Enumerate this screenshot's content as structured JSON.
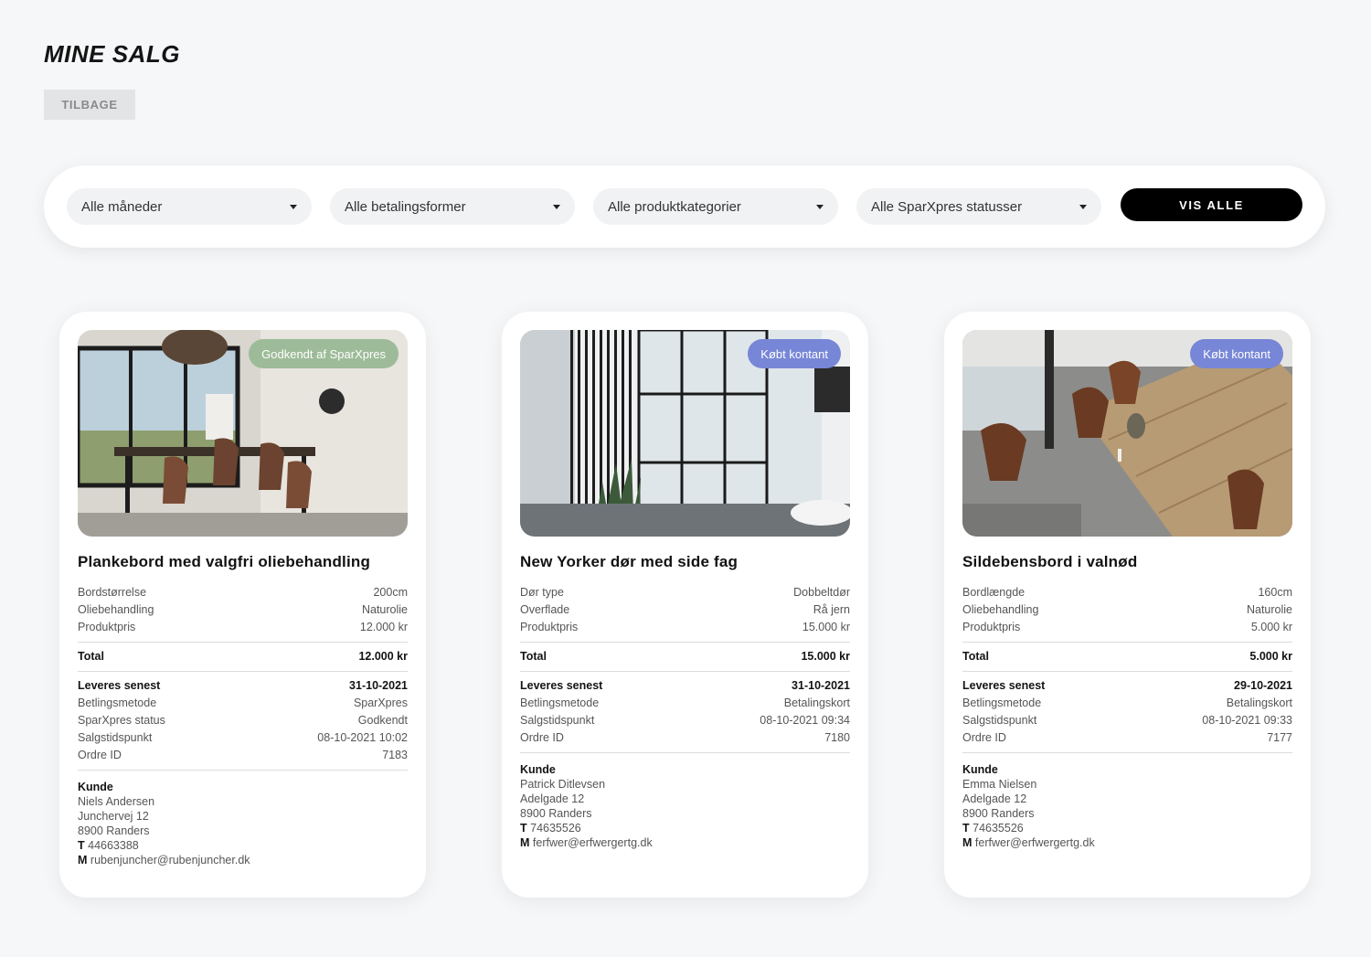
{
  "page": {
    "title": "MINE SALG",
    "back_label": "TILBAGE"
  },
  "filters": {
    "months": "Alle måneder",
    "payment": "Alle betalingsformer",
    "category": "Alle produktkategorier",
    "status": "Alle SparXpres statusser",
    "show_all": "VIS ALLE"
  },
  "colors": {
    "badge_green": "#9dbb98",
    "badge_blue": "#7786d6"
  },
  "cards": [
    {
      "badge": "Godkendt af SparXpres",
      "title": "Plankebord med valgfri oliebehandling",
      "specs": [
        {
          "label": "Bordstørrelse",
          "value": "200cm"
        },
        {
          "label": "Oliebehandling",
          "value": "Naturolie"
        },
        {
          "label": "Produktpris",
          "value": "12.000 kr"
        }
      ],
      "total": {
        "label": "Total",
        "value": "12.000 kr"
      },
      "delivery": {
        "label": "Leveres senest",
        "value": "31-10-2021"
      },
      "details": [
        {
          "label": "Betlingsmetode",
          "value": "SparXpres"
        },
        {
          "label": "SparXpres status",
          "value": "Godkendt"
        },
        {
          "label": "Salgstidspunkt",
          "value": "08-10-2021 10:02"
        },
        {
          "label": "Ordre ID",
          "value": "7183"
        }
      ],
      "customer": {
        "heading": "Kunde",
        "name": "Niels Andersen",
        "street": "Junchervej 12",
        "city": "8900 Randers",
        "phone_prefix": "T",
        "phone": "44663388",
        "mail_prefix": "M",
        "email": "rubenjuncher@rubenjuncher.dk"
      }
    },
    {
      "badge": "Købt kontant",
      "title": "New Yorker dør med side fag",
      "specs": [
        {
          "label": "Dør type",
          "value": "Dobbeltdør"
        },
        {
          "label": "Overflade",
          "value": "Rå jern"
        },
        {
          "label": "Produktpris",
          "value": "15.000 kr"
        }
      ],
      "total": {
        "label": "Total",
        "value": "15.000 kr"
      },
      "delivery": {
        "label": "Leveres senest",
        "value": "31-10-2021"
      },
      "details": [
        {
          "label": "Betlingsmetode",
          "value": "Betalingskort"
        },
        {
          "label": "Salgstidspunkt",
          "value": "08-10-2021 09:34"
        },
        {
          "label": "Ordre ID",
          "value": "7180"
        }
      ],
      "customer": {
        "heading": "Kunde",
        "name": "Patrick Ditlevsen",
        "street": "Adelgade 12",
        "city": "8900 Randers",
        "phone_prefix": "T",
        "phone": "74635526",
        "mail_prefix": "M",
        "email": "ferfwer@erfwergertg.dk"
      }
    },
    {
      "badge": "Købt kontant",
      "title": "Sildebensbord i valnød",
      "specs": [
        {
          "label": "Bordlængde",
          "value": "160cm"
        },
        {
          "label": "Oliebehandling",
          "value": "Naturolie"
        },
        {
          "label": "Produktpris",
          "value": "5.000 kr"
        }
      ],
      "total": {
        "label": "Total",
        "value": "5.000 kr"
      },
      "delivery": {
        "label": "Leveres senest",
        "value": "29-10-2021"
      },
      "details": [
        {
          "label": "Betlingsmetode",
          "value": "Betalingskort"
        },
        {
          "label": "Salgstidspunkt",
          "value": "08-10-2021 09:33"
        },
        {
          "label": "Ordre ID",
          "value": "7177"
        }
      ],
      "customer": {
        "heading": "Kunde",
        "name": "Emma Nielsen",
        "street": "Adelgade 12",
        "city": "8900 Randers",
        "phone_prefix": "T",
        "phone": "74635526",
        "mail_prefix": "M",
        "email": "ferfwer@erfwergertg.dk"
      }
    }
  ]
}
